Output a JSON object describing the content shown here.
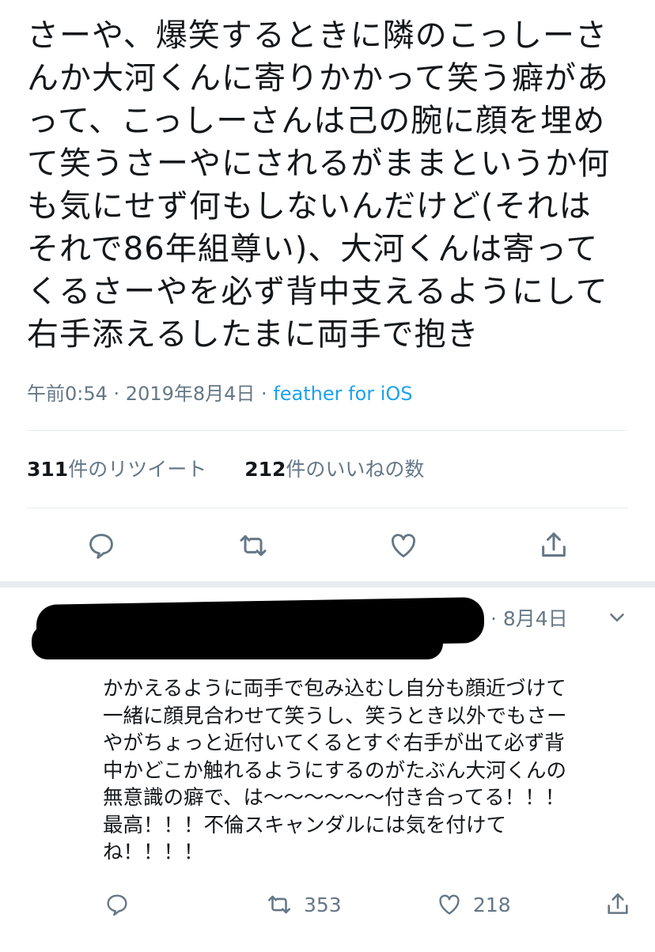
{
  "tweet": {
    "text": "さーや、爆笑するときに隣のこっしーさ\nんか大河くんに寄りかかって笑う癖があ\nって、こっしーさんは己の腕に顔を埋め\nて笑うさーやにされるがままというか何\nも気にせず何もしないんだけど(それは\nそれで86年組尊い)、大河くんは寄って\nくるさーやを必ず背中支えるようにして\n右手添えるしたまに両手で抱き",
    "time": "午前0:54",
    "dot": " · ",
    "date": "2019年8月4日",
    "dot2": " · ",
    "source": "feather for iOS"
  },
  "stats": {
    "retweets_count": "311",
    "retweets_label": "件のリツイート",
    "likes_count": "212",
    "likes_label": "件のいいねの数"
  },
  "reply": {
    "date": "· 8月4日",
    "text": "かかえるように両手で包み込むし自分も顔近づけて\n一緒に顔見合わせて笑うし、笑うとき以外でもさー\nやがちょっと近付いてくるとすぐ右手が出て必ず背\n中かどこか触れるようにするのがたぶん大河くんの\n無意識の癖で、は〜〜〜〜〜〜付き合ってる！！！\n最高！！！不倫スキャンダルには気を付けて\nね！！！！",
    "retweet_count": "353",
    "like_count": "218"
  },
  "icons": {
    "reply": "comment-icon",
    "retweet": "retweet-icon",
    "like": "heart-icon",
    "share": "share-icon",
    "more": "chevron-down-icon"
  },
  "colors": {
    "text": "#14171a",
    "muted": "#657786",
    "link": "#1da1f2",
    "divider": "#e6ecf0"
  }
}
